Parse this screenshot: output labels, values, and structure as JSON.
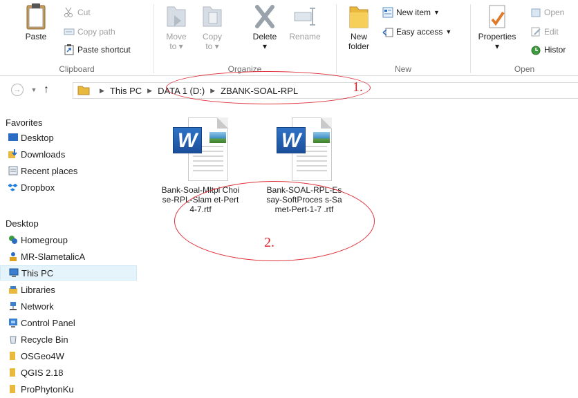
{
  "ribbon": {
    "clipboard": {
      "label": "Clipboard",
      "paste": "Paste",
      "cut": "Cut",
      "copy_path": "Copy path",
      "paste_shortcut": "Paste shortcut"
    },
    "organize": {
      "label": "Organize",
      "move_to": "Move",
      "move_to_2": "to",
      "copy_to": "Copy",
      "copy_to_2": "to",
      "delete": "Delete",
      "rename": "Rename"
    },
    "new": {
      "label": "New",
      "new_folder": "New",
      "new_folder_2": "folder",
      "new_item": "New item",
      "easy_access": "Easy access"
    },
    "open": {
      "label": "Open",
      "properties": "Properties",
      "open": "Open",
      "edit": "Edit",
      "history": "Histor"
    }
  },
  "address": {
    "crumbs": [
      "This PC",
      "DATA 1 (D:)",
      "ZBANK-SOAL-RPL"
    ]
  },
  "sidebar": {
    "favorites_header": "Favorites",
    "favorites": [
      "Desktop",
      "Downloads",
      "Recent places",
      "Dropbox"
    ],
    "desktop_header": "Desktop",
    "desktop_items": [
      "Homegroup",
      "MR-SlametalicA",
      "This PC",
      "Libraries",
      "Network",
      "Control Panel",
      "Recycle Bin",
      "OSGeo4W",
      "QGIS 2.18",
      "ProPhytonKu"
    ],
    "selected": "This PC"
  },
  "files": [
    {
      "name": "Bank-Soal-Mltpl Choise-RPL-Slam et-Pert4-7.rtf",
      "type": "word-rtf"
    },
    {
      "name": "Bank-SOAL-RPL-Essay-SoftProces s-Samet-Pert-1-7 .rtf",
      "type": "word-rtf"
    }
  ],
  "annotations": {
    "one": "1.",
    "two": "2."
  },
  "colors": {
    "annotation": "#e0323b",
    "selected_bg": "#e5f3fb",
    "word_blue": "#2b6cc4"
  }
}
